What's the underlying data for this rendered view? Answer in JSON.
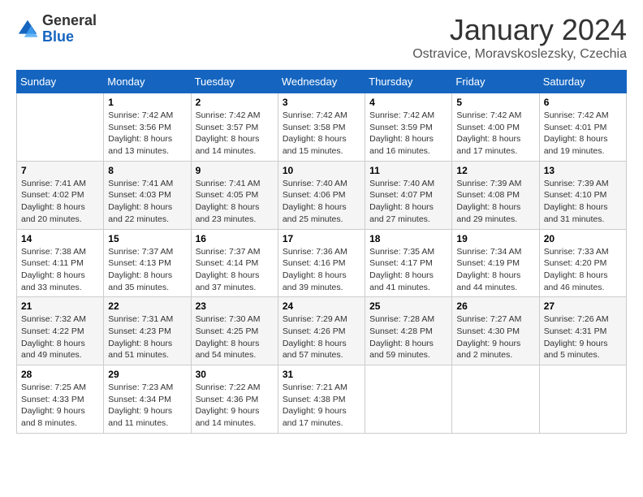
{
  "logo": {
    "general": "General",
    "blue": "Blue"
  },
  "header": {
    "month": "January 2024",
    "location": "Ostravice, Moravskoslezsky, Czechia"
  },
  "weekdays": [
    "Sunday",
    "Monday",
    "Tuesday",
    "Wednesday",
    "Thursday",
    "Friday",
    "Saturday"
  ],
  "weeks": [
    [
      {
        "day": "",
        "info": ""
      },
      {
        "day": "1",
        "info": "Sunrise: 7:42 AM\nSunset: 3:56 PM\nDaylight: 8 hours\nand 13 minutes."
      },
      {
        "day": "2",
        "info": "Sunrise: 7:42 AM\nSunset: 3:57 PM\nDaylight: 8 hours\nand 14 minutes."
      },
      {
        "day": "3",
        "info": "Sunrise: 7:42 AM\nSunset: 3:58 PM\nDaylight: 8 hours\nand 15 minutes."
      },
      {
        "day": "4",
        "info": "Sunrise: 7:42 AM\nSunset: 3:59 PM\nDaylight: 8 hours\nand 16 minutes."
      },
      {
        "day": "5",
        "info": "Sunrise: 7:42 AM\nSunset: 4:00 PM\nDaylight: 8 hours\nand 17 minutes."
      },
      {
        "day": "6",
        "info": "Sunrise: 7:42 AM\nSunset: 4:01 PM\nDaylight: 8 hours\nand 19 minutes."
      }
    ],
    [
      {
        "day": "7",
        "info": "Sunrise: 7:41 AM\nSunset: 4:02 PM\nDaylight: 8 hours\nand 20 minutes."
      },
      {
        "day": "8",
        "info": "Sunrise: 7:41 AM\nSunset: 4:03 PM\nDaylight: 8 hours\nand 22 minutes."
      },
      {
        "day": "9",
        "info": "Sunrise: 7:41 AM\nSunset: 4:05 PM\nDaylight: 8 hours\nand 23 minutes."
      },
      {
        "day": "10",
        "info": "Sunrise: 7:40 AM\nSunset: 4:06 PM\nDaylight: 8 hours\nand 25 minutes."
      },
      {
        "day": "11",
        "info": "Sunrise: 7:40 AM\nSunset: 4:07 PM\nDaylight: 8 hours\nand 27 minutes."
      },
      {
        "day": "12",
        "info": "Sunrise: 7:39 AM\nSunset: 4:08 PM\nDaylight: 8 hours\nand 29 minutes."
      },
      {
        "day": "13",
        "info": "Sunrise: 7:39 AM\nSunset: 4:10 PM\nDaylight: 8 hours\nand 31 minutes."
      }
    ],
    [
      {
        "day": "14",
        "info": "Sunrise: 7:38 AM\nSunset: 4:11 PM\nDaylight: 8 hours\nand 33 minutes."
      },
      {
        "day": "15",
        "info": "Sunrise: 7:37 AM\nSunset: 4:13 PM\nDaylight: 8 hours\nand 35 minutes."
      },
      {
        "day": "16",
        "info": "Sunrise: 7:37 AM\nSunset: 4:14 PM\nDaylight: 8 hours\nand 37 minutes."
      },
      {
        "day": "17",
        "info": "Sunrise: 7:36 AM\nSunset: 4:16 PM\nDaylight: 8 hours\nand 39 minutes."
      },
      {
        "day": "18",
        "info": "Sunrise: 7:35 AM\nSunset: 4:17 PM\nDaylight: 8 hours\nand 41 minutes."
      },
      {
        "day": "19",
        "info": "Sunrise: 7:34 AM\nSunset: 4:19 PM\nDaylight: 8 hours\nand 44 minutes."
      },
      {
        "day": "20",
        "info": "Sunrise: 7:33 AM\nSunset: 4:20 PM\nDaylight: 8 hours\nand 46 minutes."
      }
    ],
    [
      {
        "day": "21",
        "info": "Sunrise: 7:32 AM\nSunset: 4:22 PM\nDaylight: 8 hours\nand 49 minutes."
      },
      {
        "day": "22",
        "info": "Sunrise: 7:31 AM\nSunset: 4:23 PM\nDaylight: 8 hours\nand 51 minutes."
      },
      {
        "day": "23",
        "info": "Sunrise: 7:30 AM\nSunset: 4:25 PM\nDaylight: 8 hours\nand 54 minutes."
      },
      {
        "day": "24",
        "info": "Sunrise: 7:29 AM\nSunset: 4:26 PM\nDaylight: 8 hours\nand 57 minutes."
      },
      {
        "day": "25",
        "info": "Sunrise: 7:28 AM\nSunset: 4:28 PM\nDaylight: 8 hours\nand 59 minutes."
      },
      {
        "day": "26",
        "info": "Sunrise: 7:27 AM\nSunset: 4:30 PM\nDaylight: 9 hours\nand 2 minutes."
      },
      {
        "day": "27",
        "info": "Sunrise: 7:26 AM\nSunset: 4:31 PM\nDaylight: 9 hours\nand 5 minutes."
      }
    ],
    [
      {
        "day": "28",
        "info": "Sunrise: 7:25 AM\nSunset: 4:33 PM\nDaylight: 9 hours\nand 8 minutes."
      },
      {
        "day": "29",
        "info": "Sunrise: 7:23 AM\nSunset: 4:34 PM\nDaylight: 9 hours\nand 11 minutes."
      },
      {
        "day": "30",
        "info": "Sunrise: 7:22 AM\nSunset: 4:36 PM\nDaylight: 9 hours\nand 14 minutes."
      },
      {
        "day": "31",
        "info": "Sunrise: 7:21 AM\nSunset: 4:38 PM\nDaylight: 9 hours\nand 17 minutes."
      },
      {
        "day": "",
        "info": ""
      },
      {
        "day": "",
        "info": ""
      },
      {
        "day": "",
        "info": ""
      }
    ]
  ]
}
